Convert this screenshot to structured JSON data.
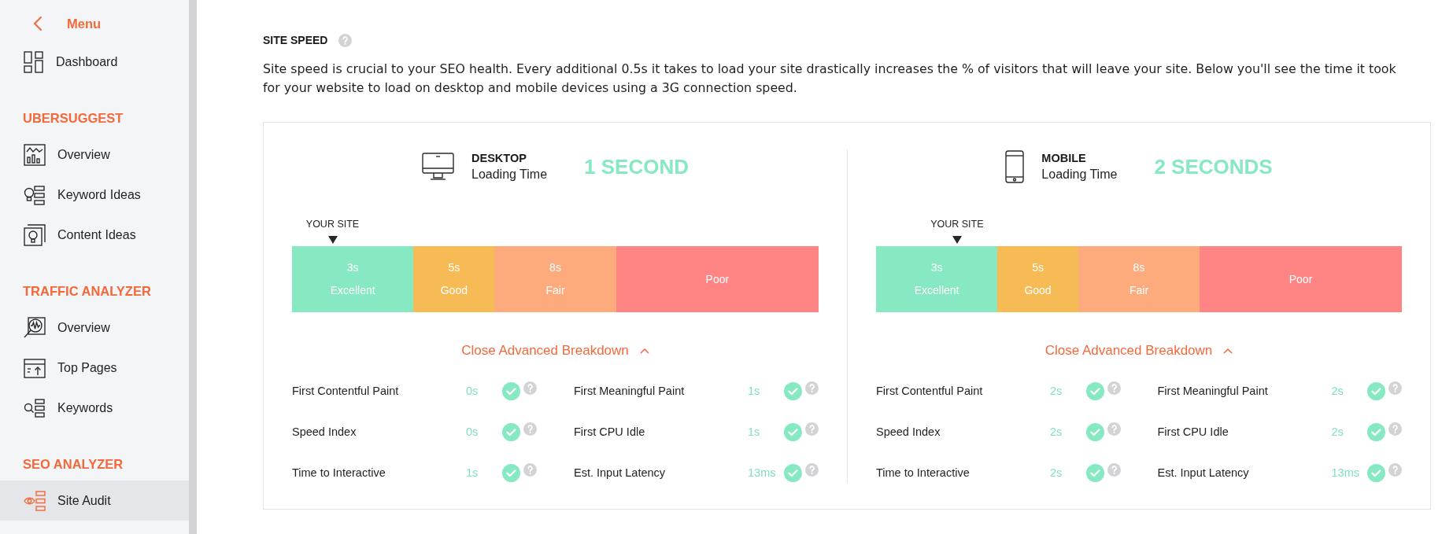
{
  "sidebar": {
    "back_label": "Menu",
    "items": [
      {
        "label": "Dashboard",
        "selected": false
      }
    ],
    "sections": [
      {
        "title": "UBERSUGGEST",
        "items": [
          {
            "label": "Overview",
            "selected": false
          },
          {
            "label": "Keyword Ideas",
            "selected": false
          },
          {
            "label": "Content Ideas",
            "selected": false
          }
        ]
      },
      {
        "title": "TRAFFIC ANALYZER",
        "items": [
          {
            "label": "Overview",
            "selected": false
          },
          {
            "label": "Top Pages",
            "selected": false
          },
          {
            "label": "Keywords",
            "selected": false
          }
        ]
      },
      {
        "title": "SEO ANALYZER",
        "items": [
          {
            "label": "Site Audit",
            "selected": true
          }
        ]
      }
    ]
  },
  "site_speed": {
    "title": "SITE SPEED",
    "description": "Site speed is crucial to your SEO health. Every additional 0.5s it takes to load your site drastically increases the % of visitors that will leave your site. Below you'll see the time it took for your website to load on desktop and mobile devices using a 3G connection speed.",
    "panels": [
      {
        "kind": "desktop",
        "device": "DESKTOP",
        "subtitle": "Loading Time",
        "result": "1 SECOND",
        "marker": {
          "label": "YOUR SITE",
          "level": 0.077
        },
        "scale": [
          {
            "threshold": "3s",
            "rating": "Excellent",
            "color": "#86e9c2"
          },
          {
            "threshold": "5s",
            "rating": "Good",
            "color": "#f6bb55"
          },
          {
            "threshold": "8s",
            "rating": "Fair",
            "color": "#fdab7c"
          },
          {
            "rating": "Poor",
            "color": "#ff8585"
          }
        ],
        "breakdown": {
          "label": "Close Advanced Breakdown",
          "expanded": true
        },
        "metrics": [
          {
            "label": "First Contentful Paint",
            "value": "0s",
            "passed": true
          },
          {
            "label": "First Meaningful Paint",
            "value": "1s",
            "passed": true
          },
          {
            "label": "Speed Index",
            "value": "0s",
            "passed": true
          },
          {
            "label": "First CPU Idle",
            "value": "1s",
            "passed": true
          },
          {
            "label": "Time to Interactive",
            "value": "1s",
            "passed": true
          },
          {
            "label": "Est. Input Latency",
            "value": "13ms",
            "passed": true
          }
        ]
      },
      {
        "kind": "mobile",
        "device": "MOBILE",
        "subtitle": "Loading Time",
        "result": "2 SECONDS",
        "marker": {
          "label": "YOUR SITE",
          "level": 0.154
        },
        "scale": [
          {
            "threshold": "3s",
            "rating": "Excellent",
            "color": "#86e9c2"
          },
          {
            "threshold": "5s",
            "rating": "Good",
            "color": "#f6bb55"
          },
          {
            "threshold": "8s",
            "rating": "Fair",
            "color": "#fdab7c"
          },
          {
            "rating": "Poor",
            "color": "#ff8585"
          }
        ],
        "breakdown": {
          "label": "Close Advanced Breakdown",
          "expanded": true
        },
        "metrics": [
          {
            "label": "First Contentful Paint",
            "value": "2s",
            "passed": true
          },
          {
            "label": "First Meaningful Paint",
            "value": "2s",
            "passed": true
          },
          {
            "label": "Speed Index",
            "value": "2s",
            "passed": true
          },
          {
            "label": "First CPU Idle",
            "value": "2s",
            "passed": true
          },
          {
            "label": "Time to Interactive",
            "value": "2s",
            "passed": true
          },
          {
            "label": "Est. Input Latency",
            "value": "13ms",
            "passed": true
          }
        ]
      }
    ]
  }
}
